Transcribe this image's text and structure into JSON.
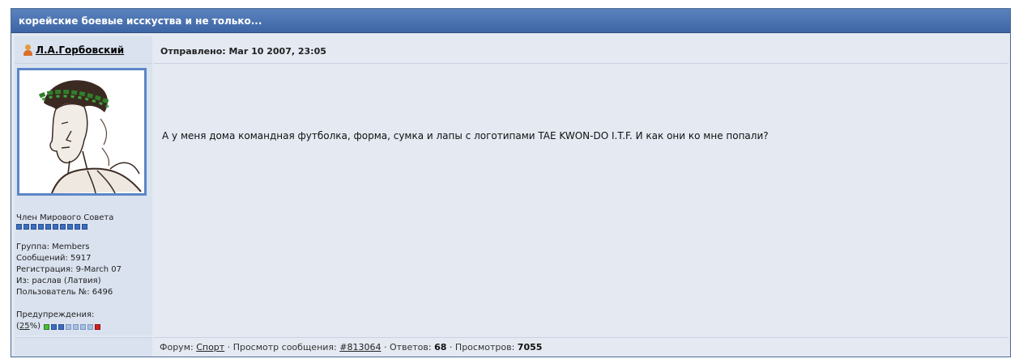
{
  "topic": {
    "title": "корейские боевые исскуства и не только..."
  },
  "post": {
    "author": "Л.А.Горбовский",
    "posted_label": "Отправлено: Mar 10 2007, 23:05",
    "message": "А у меня дома командная футболка, форма, сумка и лапы с логотипами TAE KWON-DO I.T.F. И как они ко мне попали?"
  },
  "profile": {
    "rank": "Член Мирового Совета",
    "rank_pips": 10,
    "group": "Группа: Members",
    "posts": "Сообщений: 5917",
    "registered": "Регистрация: 9-March 07",
    "from": "Из: раслав (Латвия)",
    "user_no": "Пользователь №: 6496",
    "warnings_label": "Предупреждения:",
    "warn_open": "(",
    "warn_percent": "25",
    "warn_close": "%)",
    "warn_level": 0.25
  },
  "footer": {
    "forum_label": "Форум:",
    "forum_link": "Спорт",
    "sep1": "·",
    "view_label": "Просмотр сообщения:",
    "post_link": "#813064",
    "sep2": "·",
    "replies_label": "Ответов:",
    "replies": "68",
    "sep3": "·",
    "views_label": "Просмотров:",
    "views": "7055"
  },
  "colors": {
    "title_bar": "#4b73b2",
    "panel_bg": "#e4e9f2",
    "left_bg": "#dae2ef",
    "avatar_border": "#5b86c6",
    "pip_blue": "#3b6fc2",
    "pip_green": "#4dbb3a",
    "pip_red": "#d42020"
  },
  "icons": {
    "user": "user-icon"
  }
}
